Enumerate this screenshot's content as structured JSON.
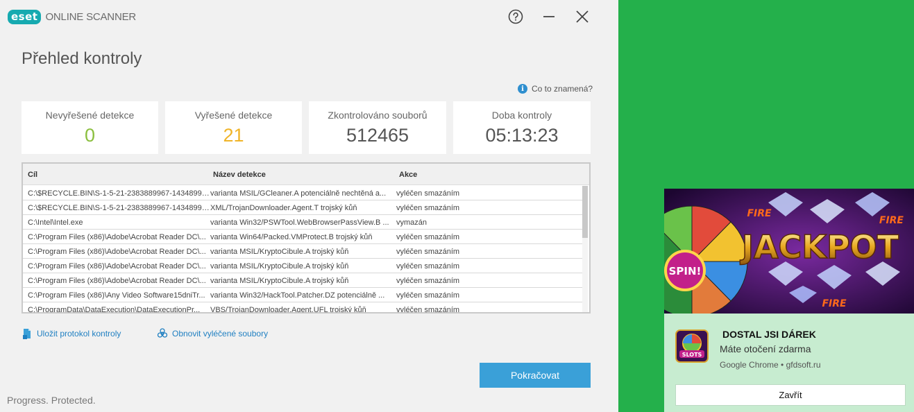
{
  "app": {
    "brand": "eset",
    "product": "ONLINE SCANNER"
  },
  "window_controls": {
    "help": "help-icon",
    "minimize": "minimize-icon",
    "close": "close-icon"
  },
  "page": {
    "title": "Přehled kontroly",
    "info_link": "Co to znamená?"
  },
  "stats": [
    {
      "label": "Nevyřešené detekce",
      "value": "0",
      "color": "#8bbf3f"
    },
    {
      "label": "Vyřešené detekce",
      "value": "21",
      "color": "#f0b428"
    },
    {
      "label": "Zkontrolováno souborů",
      "value": "512465",
      "color": "#555555"
    },
    {
      "label": "Doba kontroly",
      "value": "05:13:23",
      "color": "#555555"
    }
  ],
  "table": {
    "columns": [
      "Cíl",
      "Název detekce",
      "Akce"
    ],
    "rows": [
      [
        "C:\\$RECYCLE.BIN\\S-1-5-21-2383889967-143489943...",
        "varianta MSIL/GCleaner.A potenciálně nechtěná a...",
        "vyléčen smazáním"
      ],
      [
        "C:\\$RECYCLE.BIN\\S-1-5-21-2383889967-143489943...",
        "XML/TrojanDownloader.Agent.T trojský kůň",
        "vyléčen smazáním"
      ],
      [
        "C:\\Intel\\Intel.exe",
        "varianta Win32/PSWTool.WebBrowserPassView.B ...",
        "vymazán"
      ],
      [
        "C:\\Program Files (x86)\\Adobe\\Acrobat Reader DC\\...",
        "varianta Win64/Packed.VMProtect.B trojský kůň",
        "vyléčen smazáním"
      ],
      [
        "C:\\Program Files (x86)\\Adobe\\Acrobat Reader DC\\...",
        "varianta MSIL/KryptoCibule.A trojský kůň",
        "vyléčen smazáním"
      ],
      [
        "C:\\Program Files (x86)\\Adobe\\Acrobat Reader DC\\...",
        "varianta MSIL/KryptoCibule.A trojský kůň",
        "vyléčen smazáním"
      ],
      [
        "C:\\Program Files (x86)\\Adobe\\Acrobat Reader DC\\...",
        "varianta MSIL/KryptoCibule.A trojský kůň",
        "vyléčen smazáním"
      ],
      [
        "C:\\Program Files (x86)\\Any Video Software15dniTr...",
        "varianta Win32/HackTool.Patcher.DZ potenciálně ...",
        "vyléčen smazáním"
      ],
      [
        "C:\\ProgramData\\DataExecution\\DataExecutionPr...",
        "VBS/TrojanDownloader.Agent.UFL trojský kůň",
        "vyléčen smazáním"
      ]
    ]
  },
  "actions": {
    "save_log": "Uložit protokol kontroly",
    "restore": "Obnovit vyléčené soubory"
  },
  "buttons": {
    "continue": "Pokračovat"
  },
  "footer": {
    "tagline": "Progress. Protected."
  },
  "notification": {
    "ad_text": "JACKPOT",
    "ad_badge": "SPIN!",
    "ad_sign": "FIRE",
    "app_icon_text": "SLOTS",
    "title": "DOSTAL JSI DÁREK",
    "body": "Máte otočení zdarma",
    "source": "Google Chrome • gfdsoft.ru",
    "dismiss": "Zavřít"
  }
}
